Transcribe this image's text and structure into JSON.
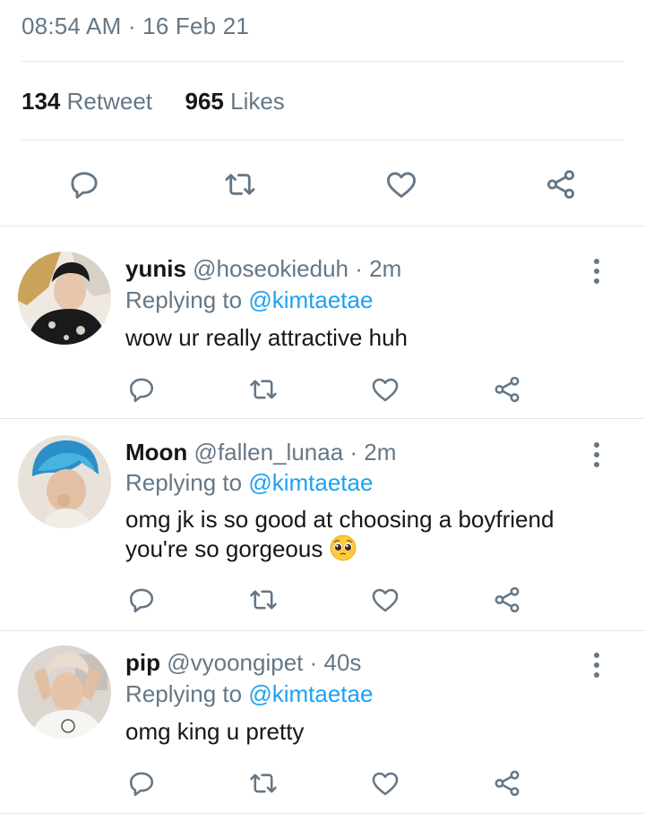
{
  "tweet": {
    "timestamp": "08:54 AM · 16 Feb 21",
    "retweet_count": "134",
    "retweet_label": "Retweet",
    "like_count": "965",
    "like_label": "Likes"
  },
  "replies": [
    {
      "name": "yunis",
      "handle": "@hoseokieduh",
      "time": "· 2m",
      "replying_prefix": "Replying to",
      "mention": "@kimtaetae",
      "text": "wow ur really attractive huh",
      "text2": ""
    },
    {
      "name": "Moon",
      "handle": "@fallen_lunaa",
      "time": "· 2m",
      "replying_prefix": "Replying to",
      "mention": "@kimtaetae",
      "text": "omg jk is so good at choosing a boyfriend",
      "text2": "you're so gorgeous",
      "emoji": "pleading-face"
    },
    {
      "name": "pip",
      "handle": "@vyoongipet",
      "time": "· 40s",
      "replying_prefix": "Replying to",
      "mention": "@kimtaetae",
      "text": "omg king u pretty",
      "text2": ""
    }
  ],
  "icons": [
    "reply-icon",
    "retweet-icon",
    "like-icon",
    "share-icon",
    "more-icon"
  ],
  "colors": {
    "muted": "#657786",
    "text": "#14171a",
    "mention": "#1da1f2",
    "divider": "#e1e8ed"
  }
}
